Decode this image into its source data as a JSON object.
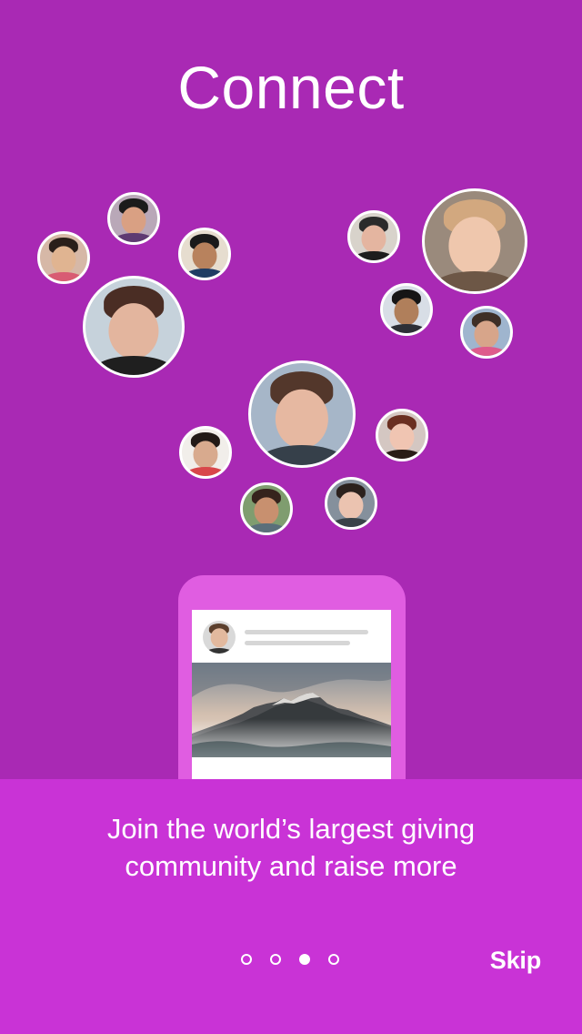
{
  "screen": {
    "title": "Connect",
    "background_color": "#a929b4",
    "panel_color": "#c933d6"
  },
  "avatars": [
    {
      "id": "woman-glasses",
      "icon": "avatar-icon",
      "skin": "#d9a083",
      "hair": "#1b1b1b",
      "shoulders": "#5e3a72",
      "bg": "#b9a8b8"
    },
    {
      "id": "child-headband",
      "icon": "avatar-icon",
      "skin": "#e0b491",
      "hair": "#2a1f1a",
      "shoulders": "#d85c73",
      "bg": "#d6b8a7"
    },
    {
      "id": "man-young",
      "icon": "avatar-icon",
      "skin": "#b8825d",
      "hair": "#1a1a1a",
      "shoulders": "#1f3c63",
      "bg": "#e6ddcf"
    },
    {
      "id": "woman-dark-hair",
      "icon": "avatar-icon",
      "skin": "#e3b59e",
      "hair": "#4a2d24",
      "shoulders": "#1f1f1f",
      "bg": "#c6d2db"
    },
    {
      "id": "yoga-person",
      "icon": "avatar-icon",
      "skin": "#e4b5a0",
      "hair": "#2b2b2b",
      "shoulders": "#1d1d1d",
      "bg": "#d8d3cb"
    },
    {
      "id": "woman-blonde-dog",
      "icon": "avatar-icon",
      "skin": "#efc7ad",
      "hair": "#d2a87f",
      "shoulders": "#6d5746",
      "bg": "#9a8a7c"
    },
    {
      "id": "man-dark",
      "icon": "avatar-icon",
      "skin": "#b07f5b",
      "hair": "#151515",
      "shoulders": "#2d2f36",
      "bg": "#d8dee6"
    },
    {
      "id": "man-outdoors",
      "icon": "avatar-icon",
      "skin": "#d7a58a",
      "hair": "#3e2f27",
      "shoulders": "#de5b8c",
      "bg": "#9fb5ce"
    },
    {
      "id": "man-beard",
      "icon": "avatar-icon",
      "skin": "#e6b8a1",
      "hair": "#53372b",
      "shoulders": "#36404a",
      "bg": "#a6b6c8"
    },
    {
      "id": "man-red-shirt",
      "icon": "avatar-icon",
      "skin": "#d8aa8e",
      "hair": "#221a17",
      "shoulders": "#d8464a",
      "bg": "#f1eeea"
    },
    {
      "id": "woman-redhead",
      "icon": "avatar-icon",
      "skin": "#f0c5b2",
      "hair": "#6a2f21",
      "shoulders": "#2a1d17",
      "bg": "#d4c7c2"
    },
    {
      "id": "woman-outdoor",
      "icon": "avatar-icon",
      "skin": "#c8906f",
      "hair": "#35231c",
      "shoulders": "#5a6f7a",
      "bg": "#7f9d6f"
    },
    {
      "id": "young-man",
      "icon": "avatar-icon",
      "skin": "#ebc3b0",
      "hair": "#2b211d",
      "shoulders": "#394248",
      "bg": "#85909c"
    }
  ],
  "phone_mock": {
    "post_avatar_icon": "avatar-icon",
    "post_image_icon": "mountain-icon"
  },
  "panel": {
    "tagline_line1": "Join the world’s largest giving",
    "tagline_line2": "community and raise more",
    "skip_label": "Skip"
  },
  "pager": {
    "count": 4,
    "active_index": 2
  }
}
